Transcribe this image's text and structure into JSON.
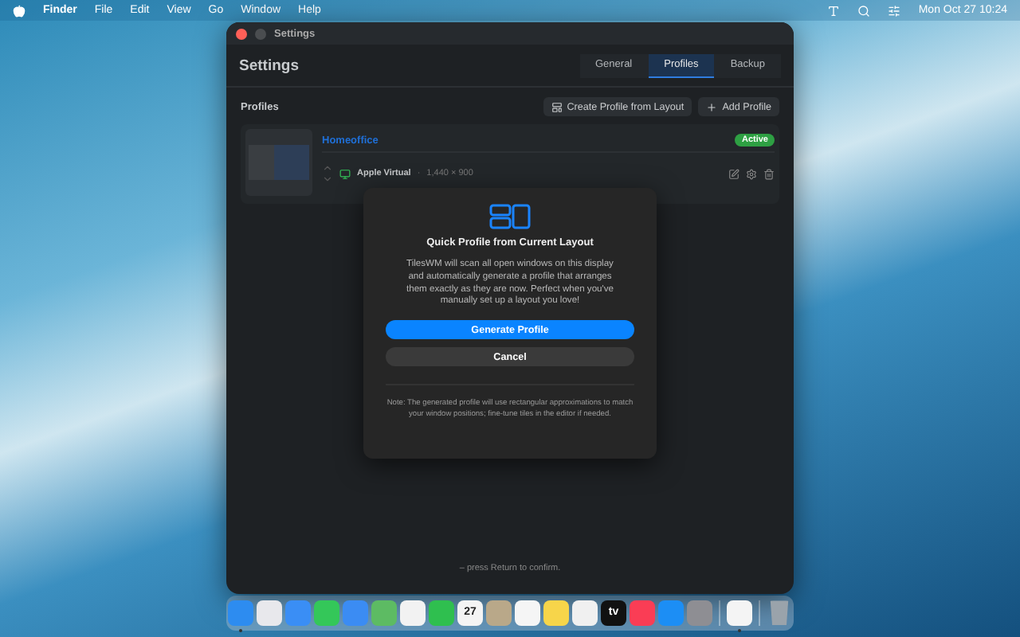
{
  "menubar": {
    "app": "Finder",
    "menus": [
      "File",
      "Edit",
      "View",
      "Go",
      "Window",
      "Help"
    ],
    "clock": "Mon Oct 27  10:24"
  },
  "window": {
    "title": "Settings",
    "heading": "Settings",
    "tabs": [
      {
        "label": "General",
        "selected": false
      },
      {
        "label": "Profiles",
        "selected": true
      },
      {
        "label": "Backup",
        "selected": false
      }
    ],
    "section_title": "Profiles",
    "actions": [
      {
        "label": "Create Profile from Layout",
        "kind": "layout"
      },
      {
        "label": "Add Profile",
        "kind": "add"
      }
    ],
    "profiles": [
      {
        "name": "Homeoffice",
        "active": true,
        "badge": "Active",
        "display": "Apple Virtual",
        "separator": "·",
        "resolution": "1,440 × 900"
      }
    ],
    "footer": "– press Return to confirm."
  },
  "dialog": {
    "title": "Quick Profile from Current Layout",
    "body": "TilesWM will scan all open windows on this display and automatically generate a profile that arranges them exactly as they are now. Perfect when you've manually set up a layout you love!",
    "primary": "Generate Profile",
    "secondary": "Cancel",
    "note": "Note: The generated profile will use rectangular approximations to match your window positions; fine-tune tiles in the editor if needed."
  },
  "dock": [
    {
      "kind": "app",
      "color": "#2d8cf0",
      "running": true
    },
    {
      "kind": "app",
      "color": "#e8e8ec",
      "running": false
    },
    {
      "kind": "app",
      "color": "#3a8ef5",
      "running": false
    },
    {
      "kind": "app",
      "color": "#34c759",
      "running": false
    },
    {
      "kind": "app",
      "color": "#3b8cf3",
      "running": false
    },
    {
      "kind": "app",
      "color": "#5dbb63",
      "running": false
    },
    {
      "kind": "app",
      "color": "#f2f2f2",
      "running": false
    },
    {
      "kind": "app",
      "color": "#2fbf4f",
      "running": false
    },
    {
      "kind": "app",
      "color": "#f4f4f4",
      "running": false,
      "label": "27"
    },
    {
      "kind": "app",
      "color": "#b9a889",
      "running": false
    },
    {
      "kind": "app",
      "color": "#f5f5f5",
      "running": false
    },
    {
      "kind": "app",
      "color": "#f7d54a",
      "running": false
    },
    {
      "kind": "app",
      "color": "#f0f0f0",
      "running": false
    },
    {
      "kind": "app",
      "color": "#111111",
      "running": false,
      "label": "tv"
    },
    {
      "kind": "app",
      "color": "#fa3d55",
      "running": false
    },
    {
      "kind": "app",
      "color": "#1c8ef5",
      "running": false
    },
    {
      "kind": "app",
      "color": "#8e8e93",
      "running": false
    },
    {
      "kind": "separator"
    },
    {
      "kind": "app",
      "color": "#f4f4f4",
      "running": true
    },
    {
      "kind": "separator"
    },
    {
      "kind": "trash",
      "color": "#9aa3ab",
      "running": false
    }
  ]
}
